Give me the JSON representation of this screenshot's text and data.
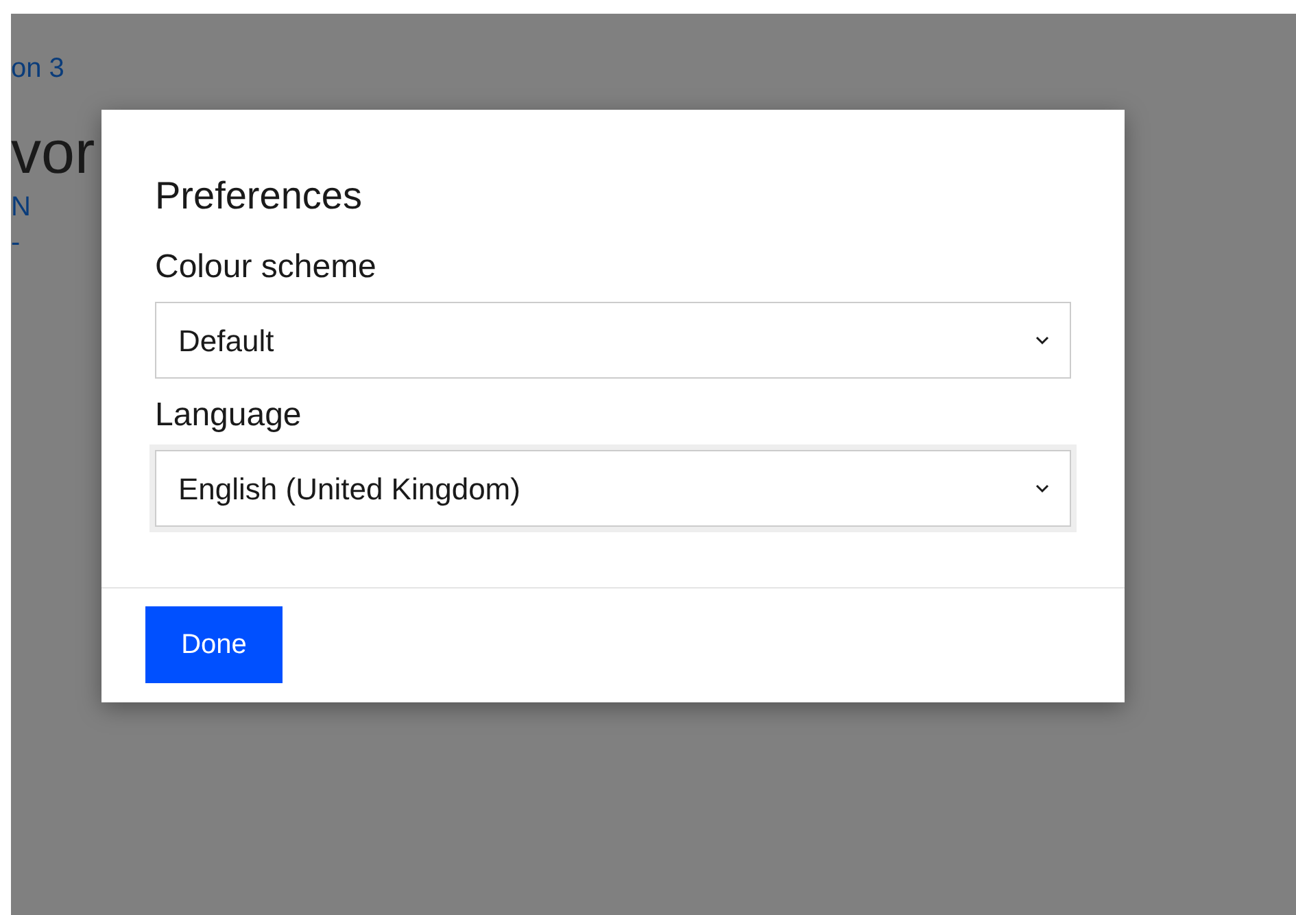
{
  "background": {
    "links": [
      "on 3"
    ],
    "heading": "vor",
    "sublinks": [
      "N",
      "-"
    ]
  },
  "dialog": {
    "title": "Preferences",
    "fields": [
      {
        "label": "Colour scheme",
        "value": "Default",
        "focused": false
      },
      {
        "label": "Language",
        "value": "English (United Kingdom)",
        "focused": true
      }
    ],
    "button": "Done"
  }
}
